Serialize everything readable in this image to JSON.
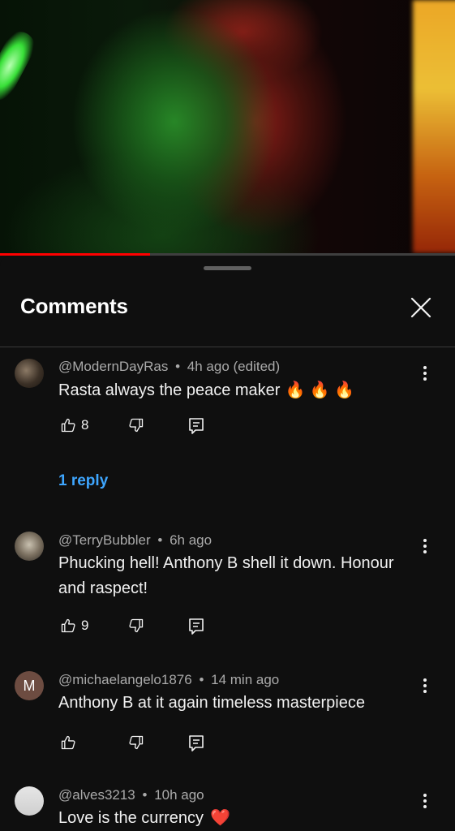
{
  "video": {
    "progress_fraction": 0.33,
    "progress_color": "#ff0000"
  },
  "sheet": {
    "title": "Comments",
    "close_icon": "close-icon"
  },
  "comments": [
    {
      "author": "@ModernDayRas",
      "time": "4h ago (edited)",
      "text": "Rasta always the peace maker",
      "emoji": "🔥 🔥 🔥",
      "likes": "8",
      "replies_label": "1 reply"
    },
    {
      "author": "@TerryBubbler",
      "time": "6h ago",
      "text": "Phucking hell! Anthony B shell it down. Honour and raspect!",
      "likes": "9"
    },
    {
      "author": "@michaelangelo1876",
      "time": "14 min ago",
      "text": "Anthony B at it again timeless masterpiece",
      "likes": "",
      "avatar_letter": "M",
      "avatar_color": "#6d4c41"
    },
    {
      "author": "@alves3213",
      "time": "10h ago",
      "text": "Love is the currency",
      "emoji": "❤️"
    }
  ],
  "separator": "•",
  "accent_link_color": "#3ea6ff"
}
